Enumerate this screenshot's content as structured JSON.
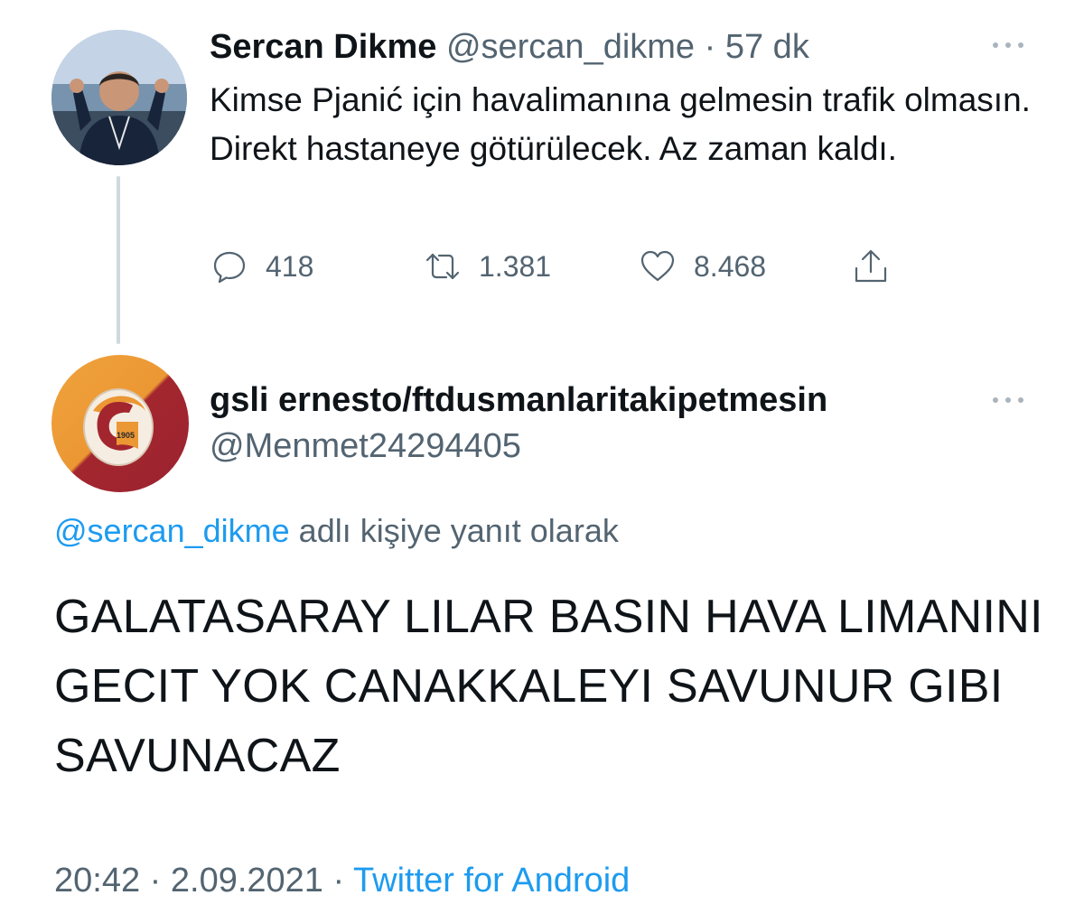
{
  "parent_tweet": {
    "author_name": "Sercan Dikme",
    "handle": "@sercan_dikme",
    "separator": "·",
    "time_ago": "57 dk",
    "text": "Kimse Pjanić için havalimanına gelmesin trafik olmasın. Direkt hastaneye götürülecek. Az zaman kaldı.",
    "replies_count": "418",
    "retweets_count": "1.381",
    "likes_count": "8.468",
    "icons": {
      "reply": "reply-icon",
      "retweet": "retweet-icon",
      "like": "heart-icon",
      "share": "share-icon",
      "more": "more-icon"
    }
  },
  "reply_tweet": {
    "author_name": "gsli ernesto/ftdusmanlaritakipetmesin",
    "handle": "@Menmet24294405",
    "replying_to_mention": "@sercan_dikme",
    "replying_to_suffix": "adlı kişiye yanıt olarak",
    "text": "GALATASARAY LILAR BASIN HAVA LIMANINI GECIT YOK CANAKKALEYI SAVUNUR GIBI SAVUNACAZ",
    "time": "20:42",
    "separator": "·",
    "date": "2.09.2021",
    "source": "Twitter for Android",
    "avatar_badge_year": "1905"
  },
  "colors": {
    "text_primary": "#0f1419",
    "text_secondary": "#536471",
    "link": "#1d9bf0",
    "thread_line": "#cfd9de",
    "avatar_orange": "#eb9734",
    "avatar_red": "#a3262e"
  }
}
